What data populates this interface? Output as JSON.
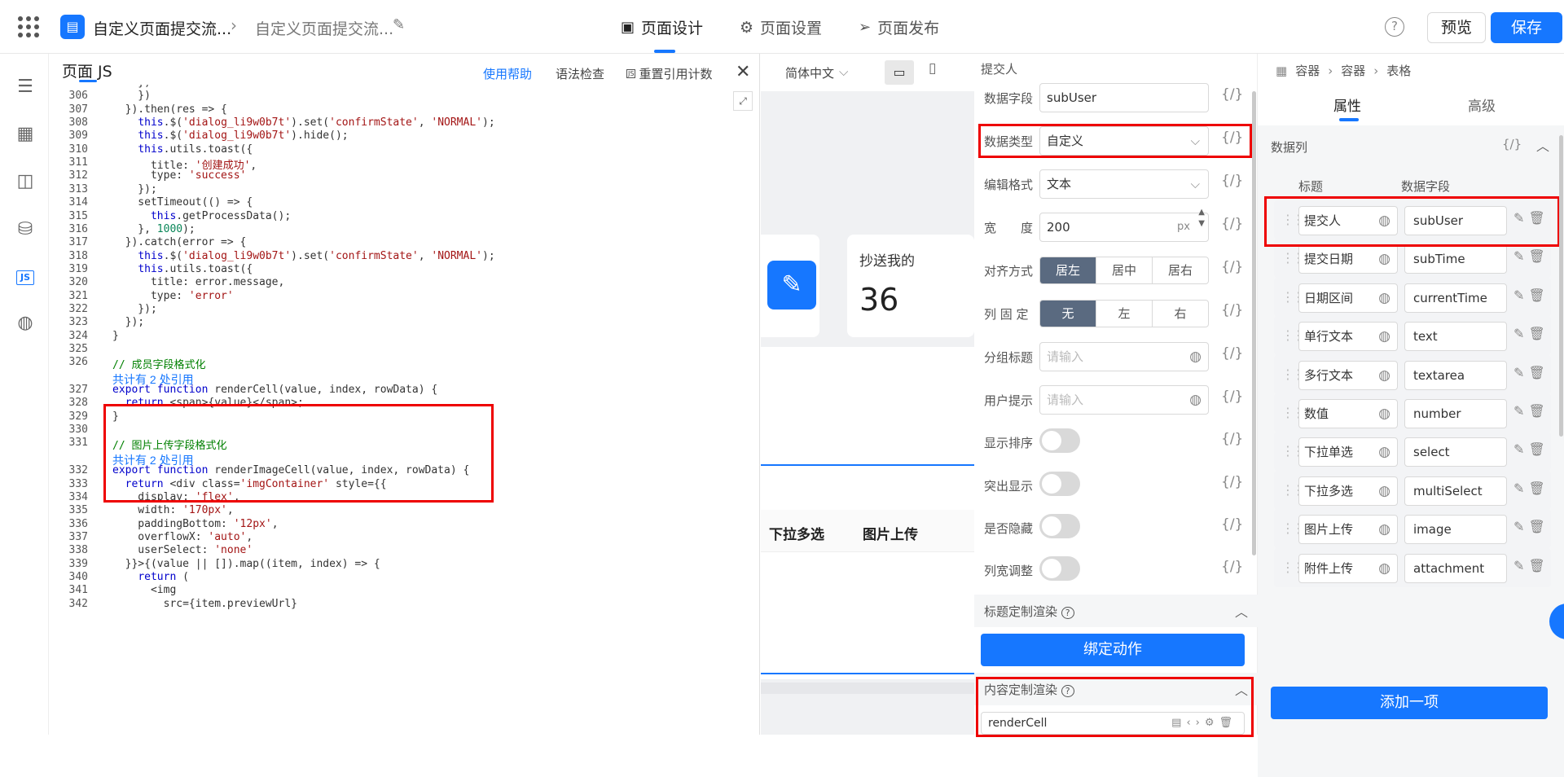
{
  "topbar": {
    "crumb1": "自定义页面提交流...",
    "crumb2": "自定义页面提交流...",
    "tabs": [
      {
        "label": "页面设计",
        "icon": "layout-icon"
      },
      {
        "label": "页面设置",
        "icon": "gear-icon"
      },
      {
        "label": "页面发布",
        "icon": "send-icon"
      }
    ],
    "preview": "预览",
    "save": "保存"
  },
  "editor": {
    "title": "页面 JS",
    "links": {
      "help": "使用帮助",
      "lint": "语法检查",
      "reset": "重置引用计数"
    },
    "lines": [
      {
        "n": "",
        "code": "    })"
      },
      {
        "n": "306",
        "code": "    })"
      },
      {
        "n": "307",
        "code": "  }).then(res => {"
      },
      {
        "n": "308",
        "code": "    this.$('dialog_li9w0b7t').set('confirmState', 'NORMAL');"
      },
      {
        "n": "309",
        "code": "    this.$('dialog_li9w0b7t').hide();"
      },
      {
        "n": "310",
        "code": "    this.utils.toast({"
      },
      {
        "n": "311",
        "code": "      title: '创建成功',"
      },
      {
        "n": "312",
        "code": "      type: 'success'"
      },
      {
        "n": "313",
        "code": "    });"
      },
      {
        "n": "314",
        "code": "    setTimeout(() => {"
      },
      {
        "n": "315",
        "code": "      this.getProcessData();"
      },
      {
        "n": "316",
        "code": "    }, 1000);"
      },
      {
        "n": "317",
        "code": "  }).catch(error => {"
      },
      {
        "n": "318",
        "code": "    this.$('dialog_li9w0b7t').set('confirmState', 'NORMAL');"
      },
      {
        "n": "319",
        "code": "    this.utils.toast({"
      },
      {
        "n": "320",
        "code": "      title: error.message,"
      },
      {
        "n": "321",
        "code": "      type: 'error'"
      },
      {
        "n": "322",
        "code": "    });"
      },
      {
        "n": "323",
        "code": "  });"
      },
      {
        "n": "324",
        "code": "}"
      },
      {
        "n": "325",
        "code": ""
      },
      {
        "n": "326",
        "code": "// 成员字段格式化"
      },
      {
        "n": "",
        "ref": "共计有 2 处引用"
      },
      {
        "n": "327",
        "code": "export function renderCell(value, index, rowData) {"
      },
      {
        "n": "328",
        "code": "  return <span>{value}</span>;"
      },
      {
        "n": "329",
        "code": "}"
      },
      {
        "n": "330",
        "code": ""
      },
      {
        "n": "331",
        "code": "// 图片上传字段格式化"
      },
      {
        "n": "",
        "ref": "共计有 2 处引用"
      },
      {
        "n": "332",
        "code": "export function renderImageCell(value, index, rowData) {"
      },
      {
        "n": "333",
        "code": "  return <div class='imgContainer' style={{"
      },
      {
        "n": "334",
        "code": "    display: 'flex',"
      },
      {
        "n": "335",
        "code": "    width: '170px',"
      },
      {
        "n": "336",
        "code": "    paddingBottom: '12px',"
      },
      {
        "n": "337",
        "code": "    overflowX: 'auto',"
      },
      {
        "n": "338",
        "code": "    userSelect: 'none'"
      },
      {
        "n": "339",
        "code": "  }}>{(value || []).map((item, index) => {"
      },
      {
        "n": "340",
        "code": "    return ("
      },
      {
        "n": "341",
        "code": "      <img"
      },
      {
        "n": "342",
        "code": "        src={item.previewUrl}"
      }
    ]
  },
  "canvas": {
    "lang": "简体中文",
    "card_label": "抄送我的",
    "card_value": "36",
    "col_a": "下拉多选",
    "col_b": "图片上传"
  },
  "props": {
    "heading": "提交人",
    "fields": [
      {
        "label": "数据字段",
        "value": "subUser"
      },
      {
        "label": "数据类型",
        "value": "自定义"
      },
      {
        "label": "编辑格式",
        "value": "文本"
      },
      {
        "label": "宽　　度",
        "value": "200",
        "unit": "px"
      }
    ],
    "align": {
      "label": "对齐方式",
      "options": [
        "居左",
        "居中",
        "居右"
      ],
      "selected": "居左"
    },
    "fixed": {
      "label": "列 固 定",
      "options": [
        "无",
        "左",
        "右"
      ],
      "selected": "无"
    },
    "group_title": {
      "label": "分组标题",
      "placeholder": "请输入"
    },
    "user_tip": {
      "label": "用户提示",
      "placeholder": "请输入"
    },
    "toggles": [
      "显示排序",
      "突出显示",
      "是否隐藏",
      "列宽调整"
    ],
    "title_render": "标题定制渲染",
    "bind_action": "绑定动作",
    "content_render": "内容定制渲染",
    "render_fn": "renderCell",
    "code_symbol": "{/}"
  },
  "rpanel": {
    "breadcrumb": [
      "容器",
      "容器",
      "表格"
    ],
    "tabs": [
      "属性",
      "高级"
    ],
    "active_tab": "属性",
    "section": "数据列",
    "col_title": "标题",
    "col_field": "数据字段",
    "rows": [
      {
        "title": "提交人",
        "field": "subUser"
      },
      {
        "title": "提交日期",
        "field": "subTime"
      },
      {
        "title": "日期区间",
        "field": "currentTime"
      },
      {
        "title": "单行文本",
        "field": "text"
      },
      {
        "title": "多行文本",
        "field": "textarea"
      },
      {
        "title": "数值",
        "field": "number"
      },
      {
        "title": "下拉单选",
        "field": "select"
      },
      {
        "title": "下拉多选",
        "field": "multiSelect"
      },
      {
        "title": "图片上传",
        "field": "image"
      },
      {
        "title": "附件上传",
        "field": "attachment"
      }
    ],
    "add_item": "添加一项"
  },
  "colors": {
    "accent": "#1677ff",
    "highlight": "#ee0000",
    "segment_on": "#5a6a80"
  }
}
